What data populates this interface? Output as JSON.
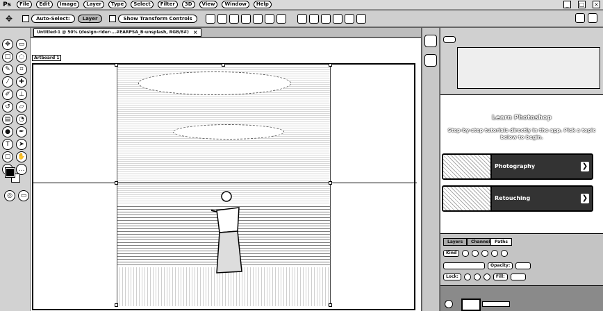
{
  "menubar": {
    "logo": "Ps",
    "items": [
      "File",
      "Edit",
      "Image",
      "Layer",
      "Type",
      "Select",
      "Filter",
      "3D",
      "View",
      "Window",
      "Help"
    ],
    "window_controls": [
      "_",
      "□",
      "×"
    ]
  },
  "options": {
    "auto_select": "Auto-Select:",
    "layer_label": "Layer",
    "show_transform": "Show Transform Controls"
  },
  "document": {
    "tab_title": "Untitled-1 @ 50% (design-rider-...#EARPSA_B-unsplash, RGB/8#)",
    "close": "×",
    "artboard_label": "Artboard 1"
  },
  "learn": {
    "title": "Learn Photoshop",
    "subtitle": "Step-by-step tutorials directly in the app. Pick a topic below to begin.",
    "tutorials": [
      {
        "label": "Photography"
      },
      {
        "label": "Retouching"
      }
    ],
    "arrow": "❯"
  },
  "layers": {
    "tabs": [
      "Layers",
      "Channels",
      "Paths"
    ],
    "kind_label": "Kind",
    "opacity_label": "Opacity:",
    "fill_label": "Fill:",
    "lock_label": "Lock:"
  },
  "colors": {
    "menubar_bg": "#d9d9d9",
    "panel_bg": "#d0d0d0",
    "canvas_bg": "#ffffff",
    "tutorial_label_bg": "#333333"
  }
}
